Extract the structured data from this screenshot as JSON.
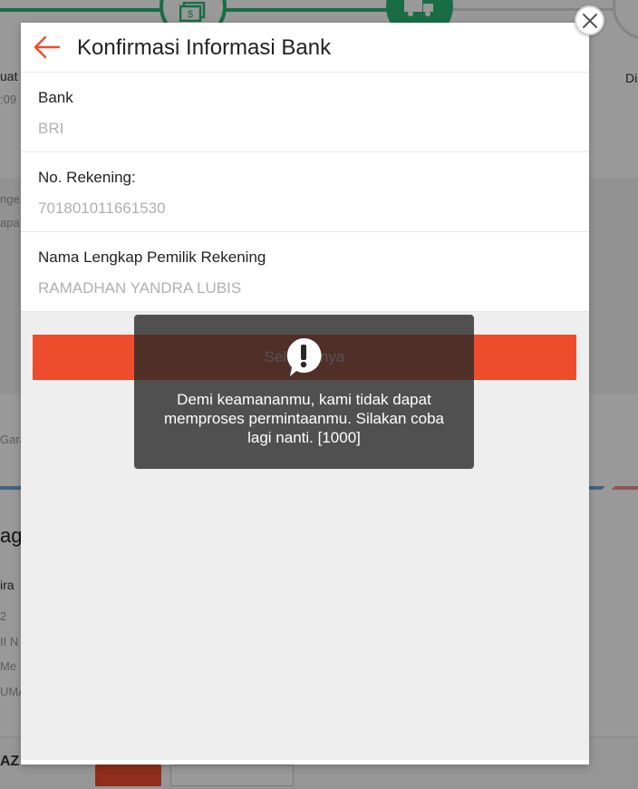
{
  "background": {
    "fragments": {
      "left_a": "uat",
      "left_a_sub": ":09",
      "right_a": "Di",
      "left_b1": "nge",
      "left_b2": "apa",
      "left_c": "Gara",
      "left_d": "agi",
      "left_e": "ira",
      "left_f": "2",
      "left_g": "II N",
      "left_h": "Me",
      "left_i": "UMA",
      "footer_left": "AZ"
    },
    "colors": {
      "progress": "#2bb673",
      "accent": "#ee4d2d"
    }
  },
  "modal": {
    "title": "Konfirmasi Informasi Bank",
    "back_icon": "arrow-left-icon",
    "fields": [
      {
        "label": "Bank",
        "value": "BRI"
      },
      {
        "label": "No. Rekening:",
        "value": "701801011661530"
      },
      {
        "label": "Nama Lengkap Pemilik Rekening",
        "value": "RAMADHAN YANDRA LUBIS"
      }
    ],
    "submit_label": "Selanjutnya",
    "close_icon": "close-icon",
    "colors": {
      "accent": "#ee4d2d",
      "value_text": "#b0b0b0"
    }
  },
  "toast": {
    "icon": "exclamation-bubble-icon",
    "message": "Demi keamananmu, kami tidak dapat memproses permintaanmu. Silakan coba lagi nanti. [1000]"
  }
}
